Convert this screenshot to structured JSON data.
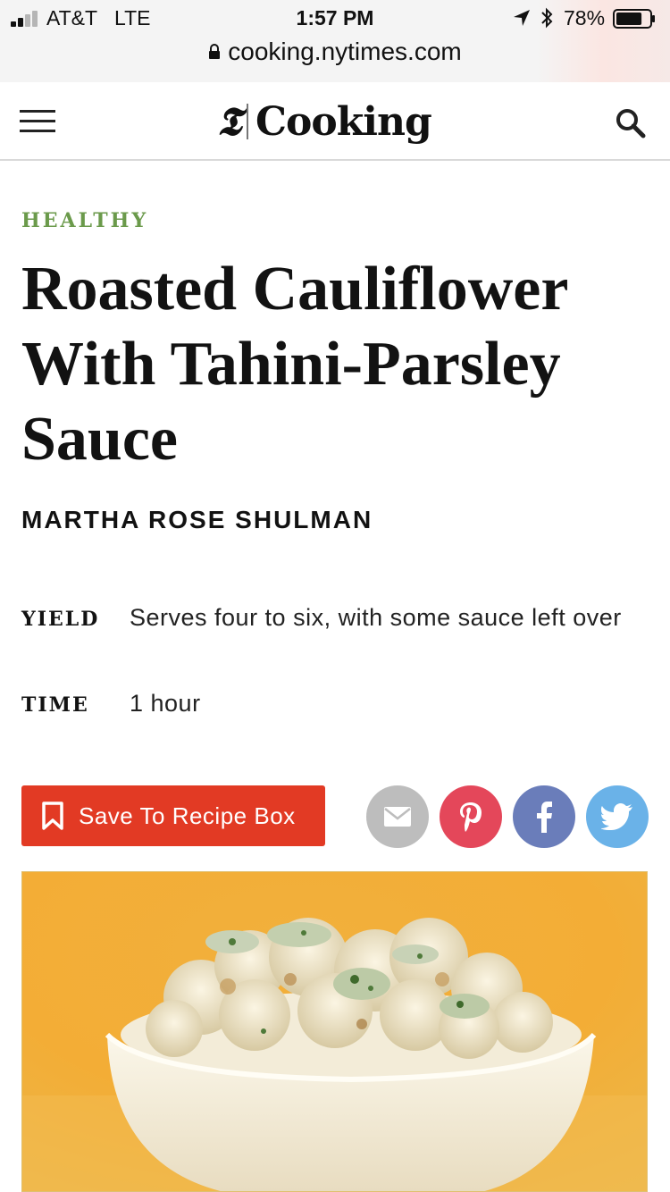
{
  "status_bar": {
    "carrier": "AT&T",
    "network": "LTE",
    "time": "1:57 PM",
    "battery": "78%",
    "battery_level": 0.78
  },
  "browser": {
    "url": "cooking.nytimes.com"
  },
  "header": {
    "logo_mark": "𝕿",
    "brand": "Cooking"
  },
  "recipe": {
    "category": "HEALTHY",
    "title": "Roasted Cauliflower With Tahini-Parsley Sauce",
    "author": "MARTHA ROSE SHULMAN",
    "yield_label": "YIELD",
    "yield_value": "Serves four to six, with some sauce left over",
    "time_label": "TIME",
    "time_value": "1 hour"
  },
  "actions": {
    "save_label": "Save To Recipe Box"
  },
  "icons": {
    "menu": "hamburger-menu-icon",
    "search": "search-icon",
    "bookmark": "bookmark-icon",
    "email": "email-icon",
    "pinterest": "pinterest-icon",
    "facebook": "facebook-icon",
    "twitter": "twitter-icon"
  },
  "colors": {
    "category": "#6b9a4b",
    "save_button": "#e23a24",
    "email": "#bdbdbd",
    "pinterest": "#e4475a",
    "facebook": "#6a7dba",
    "twitter": "#6ab2e8"
  }
}
